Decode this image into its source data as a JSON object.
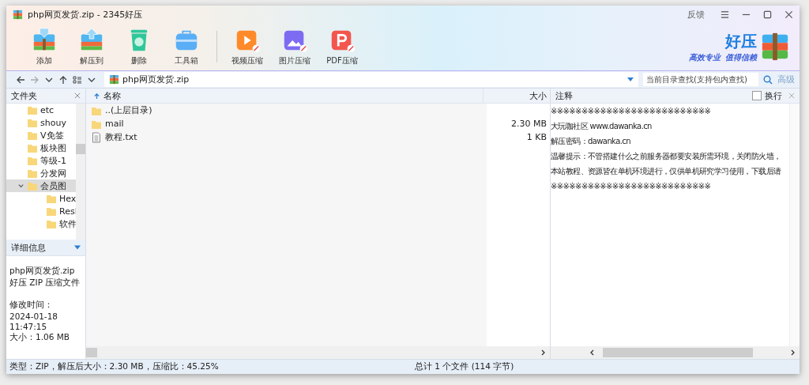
{
  "window": {
    "title": "php网页发货.zip - 2345好压",
    "feedback": "反馈"
  },
  "toolbar": [
    {
      "kind": "add",
      "label": "添加"
    },
    {
      "kind": "extract",
      "label": "解压到"
    },
    {
      "kind": "delete",
      "label": "删除"
    },
    {
      "kind": "tools",
      "label": "工具箱"
    },
    {
      "kind": "video",
      "label": "视频压缩"
    },
    {
      "kind": "image",
      "label": "图片压缩"
    },
    {
      "kind": "pdf",
      "label": "PDF压缩"
    }
  ],
  "brand": {
    "name": "好压",
    "slogan": [
      "高效专业",
      "值得信赖"
    ]
  },
  "address": {
    "path": "php网页发货.zip"
  },
  "search": {
    "placeholder": "当前目录查找(支持包内查找)",
    "advanced": "高级"
  },
  "folder_panel": {
    "title": "文件夹",
    "items": [
      {
        "name": "etc",
        "selected": false
      },
      {
        "name": "shouy",
        "selected": false
      },
      {
        "name": "V免签",
        "selected": false
      },
      {
        "name": "板块图",
        "selected": false
      },
      {
        "name": "等级-1",
        "selected": false
      },
      {
        "name": "分发网",
        "selected": false
      },
      {
        "name": "会员图",
        "selected": true,
        "expanded": true,
        "children": [
          {
            "name": "Hex",
            "selected": false
          },
          {
            "name": "Resl",
            "selected": false
          },
          {
            "name": "软件",
            "selected": false
          }
        ]
      }
    ]
  },
  "details": {
    "title": "详细信息",
    "groups": [
      [
        "php网页发货.zip",
        "好压 ZIP 压缩文件"
      ],
      [
        "修改时间：",
        "2024-01-18",
        "11:47:15",
        "大小：1.06 MB"
      ]
    ]
  },
  "file_list": {
    "columns": [
      "名称",
      "大小"
    ],
    "rows": [
      {
        "kind": "parent",
        "name": "..(上层目录)",
        "size": ""
      },
      {
        "kind": "folder",
        "name": "mail",
        "size": "2.30 MB"
      },
      {
        "kind": "text",
        "name": "教程.txt",
        "size": "1 KB"
      }
    ]
  },
  "comment": {
    "title": "注释",
    "wrap": {
      "label": "换行",
      "checked": false
    },
    "lines": [
      "※※※※※※※※※※※※※※※※※※※※※※※※※※",
      "大玩咖社区 www.dawanka.cn",
      "解压密码：dawanka.cn",
      "温馨提示：不管搭建什么之前服务器都要安装所需环境，关闭防火墙，",
      "本站教程、资源皆在单机环境进行，仅供单机研究学习使用，下载后请",
      "※※※※※※※※※※※※※※※※※※※※※※※※※※"
    ]
  },
  "status_bar": {
    "left": "类型：ZIP，解压后大小：2.30 MB，压缩比：45.25%",
    "center": "总计 1 个文件 (114 字节)"
  }
}
